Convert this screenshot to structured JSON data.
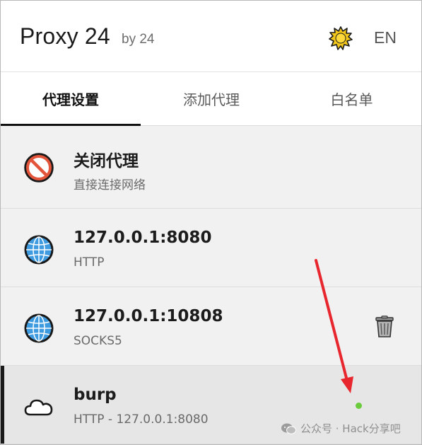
{
  "header": {
    "title": "Proxy 24",
    "subtitle": "by 24",
    "theme_icon": "sun-icon",
    "language_label": "EN"
  },
  "tabs": [
    {
      "label": "代理设置",
      "active": true
    },
    {
      "label": "添加代理",
      "active": false
    },
    {
      "label": "白名单",
      "active": false
    }
  ],
  "proxies": [
    {
      "name": "关闭代理",
      "detail": "直接连接网络",
      "icon": "no-entry-icon"
    },
    {
      "name": "127.0.0.1:8080",
      "detail": "HTTP",
      "icon": "globe-icon"
    },
    {
      "name": "127.0.0.1:10808",
      "detail": "SOCKS5",
      "icon": "globe-icon",
      "action_icon": "trash-icon"
    },
    {
      "name": "burp",
      "detail": "HTTP - 127.0.0.1:8080",
      "icon": "cloud-icon",
      "selected": true,
      "status": "active"
    }
  ],
  "colors": {
    "status_active": "#6ccb3c",
    "annotation_arrow": "#e8262d",
    "accent": "#111111"
  },
  "watermark": {
    "text": "公众号 · Hack分享吧",
    "icon": "wechat-icon"
  }
}
